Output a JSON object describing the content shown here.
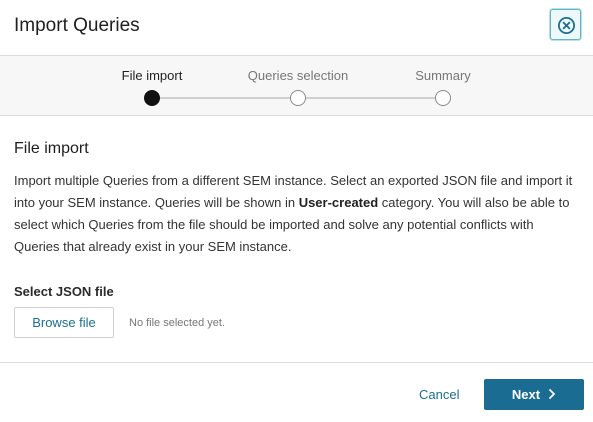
{
  "dialog": {
    "title": "Import Queries",
    "close_icon": "close-circle-icon"
  },
  "stepper": {
    "steps": [
      {
        "label": "File import",
        "state": "active"
      },
      {
        "label": "Queries selection",
        "state": "pending"
      },
      {
        "label": "Summary",
        "state": "pending"
      }
    ]
  },
  "main": {
    "section_title": "File import",
    "description_part1": "Import multiple Queries from a different SEM instance. Select an exported JSON file and import it into your SEM instance. Queries will be shown in ",
    "description_bold": "User-created",
    "description_part2": " category. You will also be able to select which Queries from the file should be imported and solve any potential conflicts with Queries that already exist in your SEM instance.",
    "field_label": "Select JSON file",
    "browse_label": "Browse file",
    "file_status": "No file selected yet."
  },
  "footer": {
    "cancel_label": "Cancel",
    "next_label": "Next",
    "next_icon": "chevron-right-icon"
  },
  "colors": {
    "accent": "#1b6c93",
    "link": "#1a6f8f",
    "close_border": "#5fb7c4"
  }
}
